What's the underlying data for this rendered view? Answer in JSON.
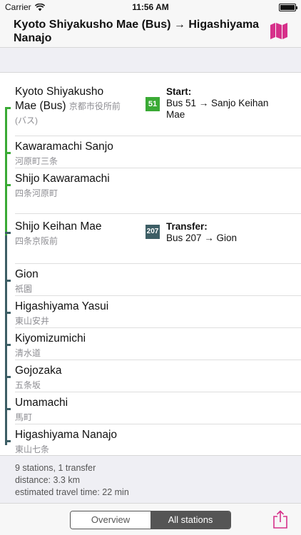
{
  "status_bar": {
    "carrier": "Carrier",
    "time": "11:56 AM"
  },
  "header": {
    "title": "Kyoto Shiyakusho Mae (Bus) → Higashiyama Nanajo",
    "map_icon": "map-icon",
    "accent_color": "#d6308a"
  },
  "stations": [
    {
      "name": "Kyoto Shiyakusho Mae (Bus)",
      "name_line1": "Kyoto Shiyakusho",
      "name_line2": "Mae (Bus)",
      "jp_line1": "京都市役所前",
      "jp_line2": "(バス)"
    },
    {
      "name": "Kawaramachi Sanjo",
      "jp": "河原町三条"
    },
    {
      "name": "Shijo Kawaramachi",
      "jp": "四条河原町"
    },
    {
      "name": "Shijo Keihan Mae",
      "jp": "四条京阪前"
    },
    {
      "name": "Gion",
      "jp": "祇園"
    },
    {
      "name": "Higashiyama Yasui",
      "jp": "東山安井"
    },
    {
      "name": "Kiyomizumichi",
      "jp": "清水道"
    },
    {
      "name": "Gojozaka",
      "jp": "五条坂"
    },
    {
      "name": "Umamachi",
      "jp": "馬町"
    },
    {
      "name": "Higashiyama Nanajo",
      "jp": "東山七条"
    }
  ],
  "routes": [
    {
      "badge": "51",
      "heading": "Start:",
      "line1": "Bus 51 → Sanjo Keihan",
      "line2": "Mae",
      "color": "#3aaa35"
    },
    {
      "badge": "207",
      "heading": "Transfer:",
      "line1": "Bus 207 → Gion",
      "color": "#3d5e65"
    }
  ],
  "summary": {
    "stations": "9 stations, 1 transfer",
    "distance": "distance: 3.3 km",
    "travel_time": "estimated travel time: 22 min"
  },
  "toolbar": {
    "segments": [
      "Overview",
      "All stations"
    ],
    "selected": "All stations",
    "share_icon": "share-icon"
  }
}
